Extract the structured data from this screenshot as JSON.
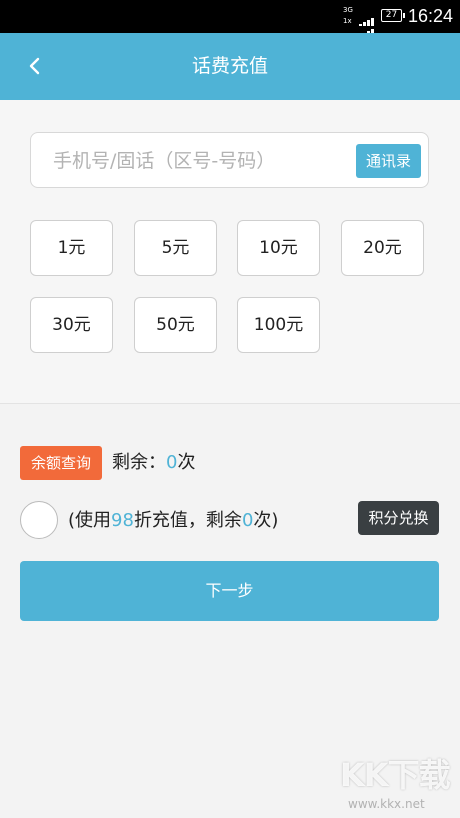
{
  "status_bar": {
    "network_top": "3G",
    "network_bottom": "1x",
    "battery": "27",
    "time": "16:24"
  },
  "header": {
    "title": "话费充值",
    "back_icon": "chevron-left-icon",
    "bg_color": "#4fb3d6"
  },
  "phone": {
    "placeholder": "手机号/固话（区号-号码）",
    "value": "",
    "contacts_label": "通讯录"
  },
  "amounts": [
    "1元",
    "5元",
    "10元",
    "20元",
    "30元",
    "50元",
    "100元"
  ],
  "balance": {
    "query_label": "余额查询",
    "remain_prefix": "剩余：",
    "remain_count": "0",
    "remain_suffix": "次"
  },
  "discount": {
    "open": "(使用",
    "rate": "98",
    "mid": "折充值，剩余",
    "count": "0",
    "close": "次)",
    "points_label": "积分兑换"
  },
  "next_label": "下一步",
  "watermark": {
    "logo": "KK下载",
    "url": "www.kkx.net"
  },
  "colors": {
    "accent": "#4fb3d6",
    "query_button": "#f26a3a",
    "points_button": "#3a3f42"
  }
}
